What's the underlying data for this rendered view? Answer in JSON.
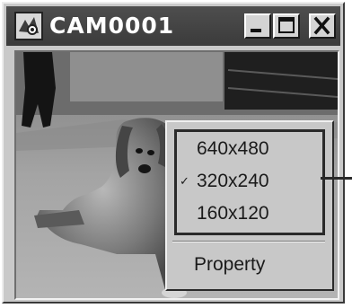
{
  "window": {
    "title": "CAM0001",
    "icon": "camera-app-icon",
    "controls": [
      "minimize-icon",
      "maximize-icon",
      "close-icon"
    ]
  },
  "menu": {
    "resolutions": [
      {
        "label": "640x480",
        "checked": false
      },
      {
        "label": "320x240",
        "checked": true
      },
      {
        "label": "160x120",
        "checked": false
      }
    ],
    "checkmark": "✓",
    "property_label": "Property"
  }
}
